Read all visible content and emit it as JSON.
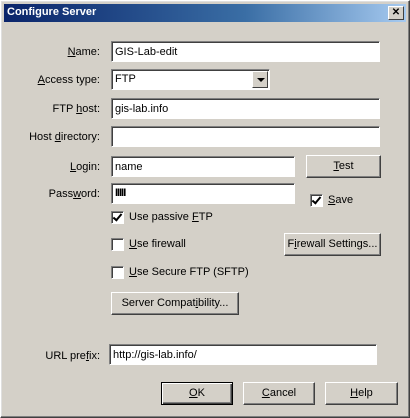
{
  "window": {
    "title": "Configure Server",
    "close_glyph": "✕"
  },
  "form": {
    "name": {
      "label_pre": "",
      "label_key": "N",
      "label_post": "ame:",
      "value": "GIS-Lab-edit"
    },
    "access_type": {
      "label_pre": "",
      "label_key": "A",
      "label_post": "ccess type:",
      "value": "FTP"
    },
    "ftp_host": {
      "label_pre": "FTP ",
      "label_key": "h",
      "label_post": "ost:",
      "value": "gis-lab.info"
    },
    "host_directory": {
      "label_pre": "Host ",
      "label_key": "d",
      "label_post": "irectory:",
      "value": ""
    },
    "login": {
      "label_pre": "",
      "label_key": "L",
      "label_post": "ogin:",
      "value": "name"
    },
    "password": {
      "label_pre": "Pass",
      "label_key": "w",
      "label_post": "ord:",
      "value": "IIIII"
    },
    "url_prefix": {
      "label_pre": "URL pre",
      "label_key": "f",
      "label_post": "ix:",
      "value": "http://gis-lab.info/"
    }
  },
  "options": {
    "save": {
      "label_pre": "",
      "label_key": "S",
      "label_post": "ave",
      "checked": true
    },
    "use_passive_ftp": {
      "label_pre": "Use passive ",
      "label_key": "F",
      "label_post": "TP",
      "checked": true
    },
    "use_firewall": {
      "label_pre": "",
      "label_key": "U",
      "label_post": "se firewall",
      "checked": false
    },
    "use_sftp": {
      "label_pre": "",
      "label_key": "U",
      "label_post": "se Secure FTP (SFTP)",
      "checked": false
    }
  },
  "buttons": {
    "test": {
      "pre": "",
      "key": "T",
      "post": "est"
    },
    "firewall_settings": {
      "pre": "F",
      "key": "i",
      "post": "rewall Settings..."
    },
    "server_compatibility": {
      "pre": "Server Compat",
      "key": "i",
      "post": "bility..."
    },
    "ok": {
      "pre": "",
      "key": "O",
      "post": "K"
    },
    "cancel": {
      "pre": "",
      "key": "C",
      "post": "ancel"
    },
    "help": {
      "pre": "",
      "key": "H",
      "post": "elp"
    }
  }
}
